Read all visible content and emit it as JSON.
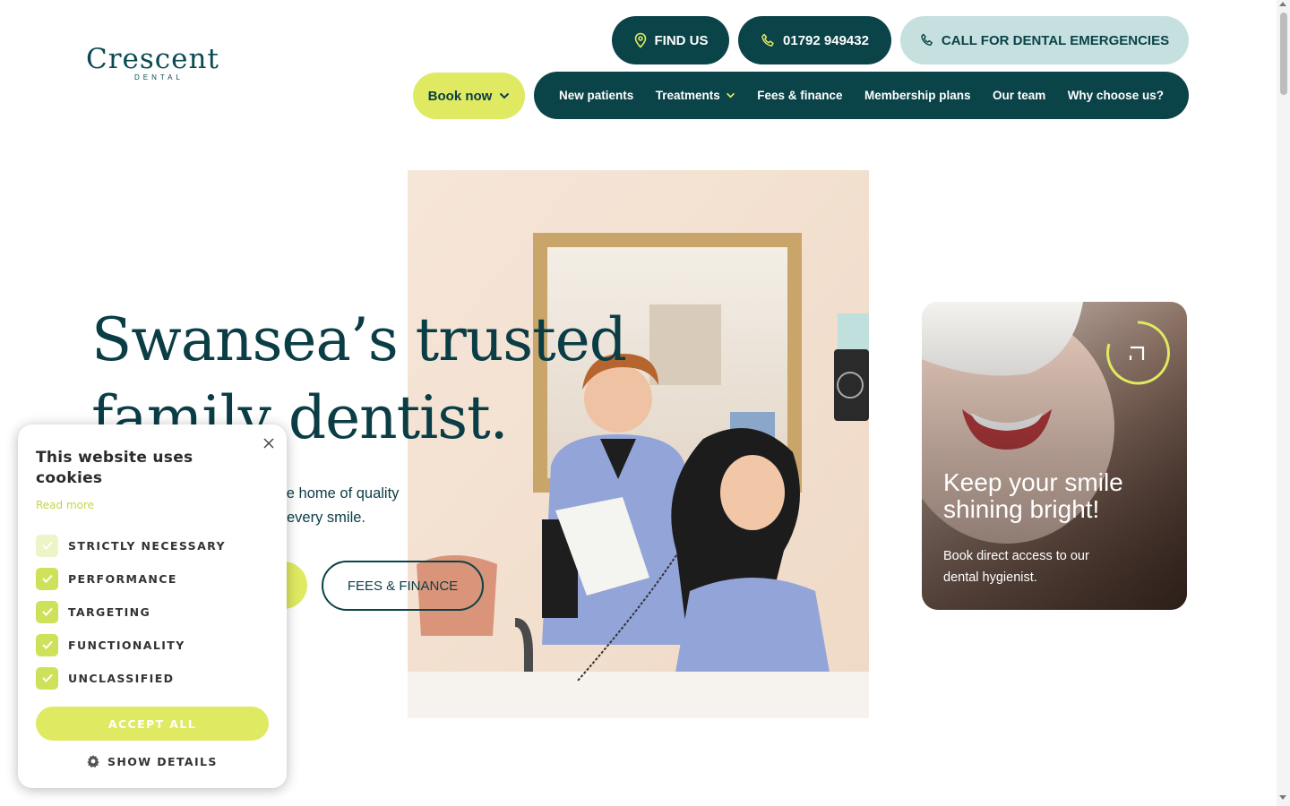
{
  "brand": {
    "name": "Crescent",
    "sub": "DENTAL",
    "color": "#0a4a52",
    "accent": "#dfe962"
  },
  "top_buttons": {
    "find_us": "FIND US",
    "phone": "01792 949432",
    "emergency": "CALL FOR DENTAL EMERGENCIES"
  },
  "nav": {
    "book_now": "Book now",
    "items": [
      {
        "label": "New patients"
      },
      {
        "label": "Treatments"
      },
      {
        "label": "Fees & finance"
      },
      {
        "label": "Membership plans"
      },
      {
        "label": "Our team"
      },
      {
        "label": "Why choose us?"
      }
    ]
  },
  "hero": {
    "title_line1": "Swansea’s trusted",
    "title_line2": "family dentist.",
    "subtitle_line1": "ul, the home of quality",
    "subtitle_line2": "every smile.",
    "fees_button": "FEES & FINANCE"
  },
  "promo": {
    "title": "Keep your smile shining bright!",
    "text": "Book direct access to our dental hygienist."
  },
  "cookie": {
    "title": "This website uses cookies",
    "read_more": "Read more",
    "options": [
      {
        "label": "STRICTLY NECESSARY",
        "checked": true,
        "disabled": true
      },
      {
        "label": "PERFORMANCE",
        "checked": true
      },
      {
        "label": "TARGETING",
        "checked": true
      },
      {
        "label": "FUNCTIONALITY",
        "checked": true
      },
      {
        "label": "UNCLASSIFIED",
        "checked": true
      }
    ],
    "accept_all": "ACCEPT ALL",
    "show_details": "SHOW DETAILS"
  }
}
